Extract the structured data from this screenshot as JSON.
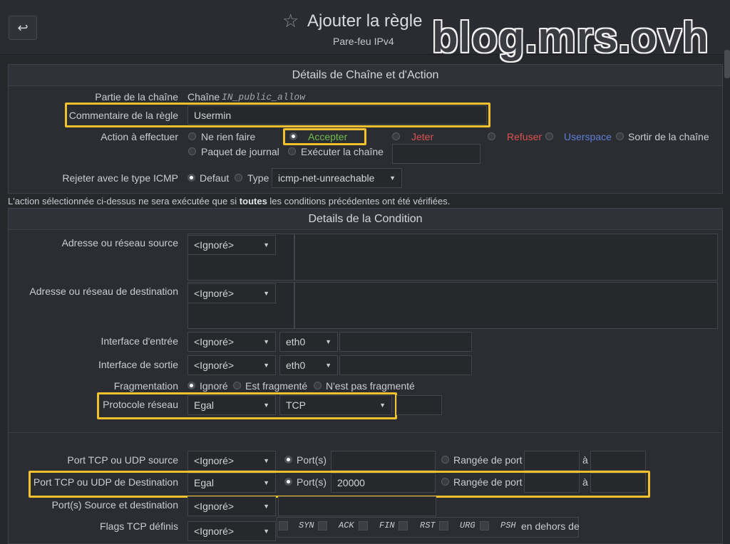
{
  "header": {
    "back_icon": "↩",
    "title": "Ajouter la règle",
    "subtitle": "Pare-feu IPv4",
    "watermark": "blog.mrs.ovh"
  },
  "section_action": {
    "title": "Détails de Chaîne et d'Action",
    "chain_part": {
      "label": "Partie de la chaîne",
      "prefix": "Chaîne",
      "value": "IN_public_allow"
    },
    "comment": {
      "label": "Commentaire de la règle",
      "value": "Usermin"
    },
    "action": {
      "label": "Action à effectuer",
      "options": {
        "nothing": "Ne rien faire",
        "accept": "Accepter",
        "drop": "Jeter",
        "reject": "Refuser",
        "userspace": "Userspace",
        "exit": "Sortir de la chaîne",
        "log": "Paquet de journal",
        "run": "Exécuter la chaîne"
      },
      "selected": "accept"
    },
    "icmp": {
      "label": "Rejeter avec le type ICMP",
      "default_label": "Defaut",
      "type_label": "Type",
      "type_value": "icmp-net-unreachable"
    }
  },
  "note": {
    "before": "L'action sélectionnée ci-dessus ne sera exécutée que si ",
    "bold": "toutes",
    "after": " les conditions précédentes ont été vérifiées."
  },
  "section_condition": {
    "title": "Details de la Condition",
    "src_addr": {
      "label": "Adresse ou réseau source",
      "select": "<Ignoré>"
    },
    "dst_addr": {
      "label": "Adresse ou réseau de destination",
      "select": "<Ignoré>"
    },
    "in_iface": {
      "label": "Interface d'entrée",
      "select": "<Ignoré>",
      "iface": "eth0"
    },
    "out_iface": {
      "label": "Interface de sortie",
      "select": "<Ignoré>",
      "iface": "eth0"
    },
    "frag": {
      "label": "Fragmentation",
      "ignored": "Ignoré",
      "fragmented": "Est fragmenté",
      "not_fragmented": "N'est pas fragmenté"
    },
    "protocol": {
      "label": "Protocole réseau",
      "select": "Egal",
      "value": "TCP"
    },
    "src_port": {
      "label": "Port TCP ou UDP source",
      "select": "<Ignoré>",
      "ports": "Port(s)",
      "range": "Rangée de port",
      "to": "à"
    },
    "dst_port": {
      "label": "Port TCP ou UDP de Destination",
      "select": "Egal",
      "ports": "Port(s)",
      "value": "20000",
      "range": "Rangée de port",
      "to": "à"
    },
    "src_dst_ports": {
      "label": "Port(s) Source et destination",
      "select": "<Ignoré>"
    },
    "tcp_flags": {
      "label": "Flags TCP définis",
      "select": "<Ignoré>",
      "flags": [
        "SYN",
        "ACK",
        "FIN",
        "RST",
        "URG",
        "PSH"
      ],
      "suffix": "en dehors de"
    }
  },
  "colors": {
    "highlight": "#f2c12e",
    "accept": "#6dbd4c",
    "drop": "#d9534f",
    "userspace": "#5b7fd6"
  }
}
